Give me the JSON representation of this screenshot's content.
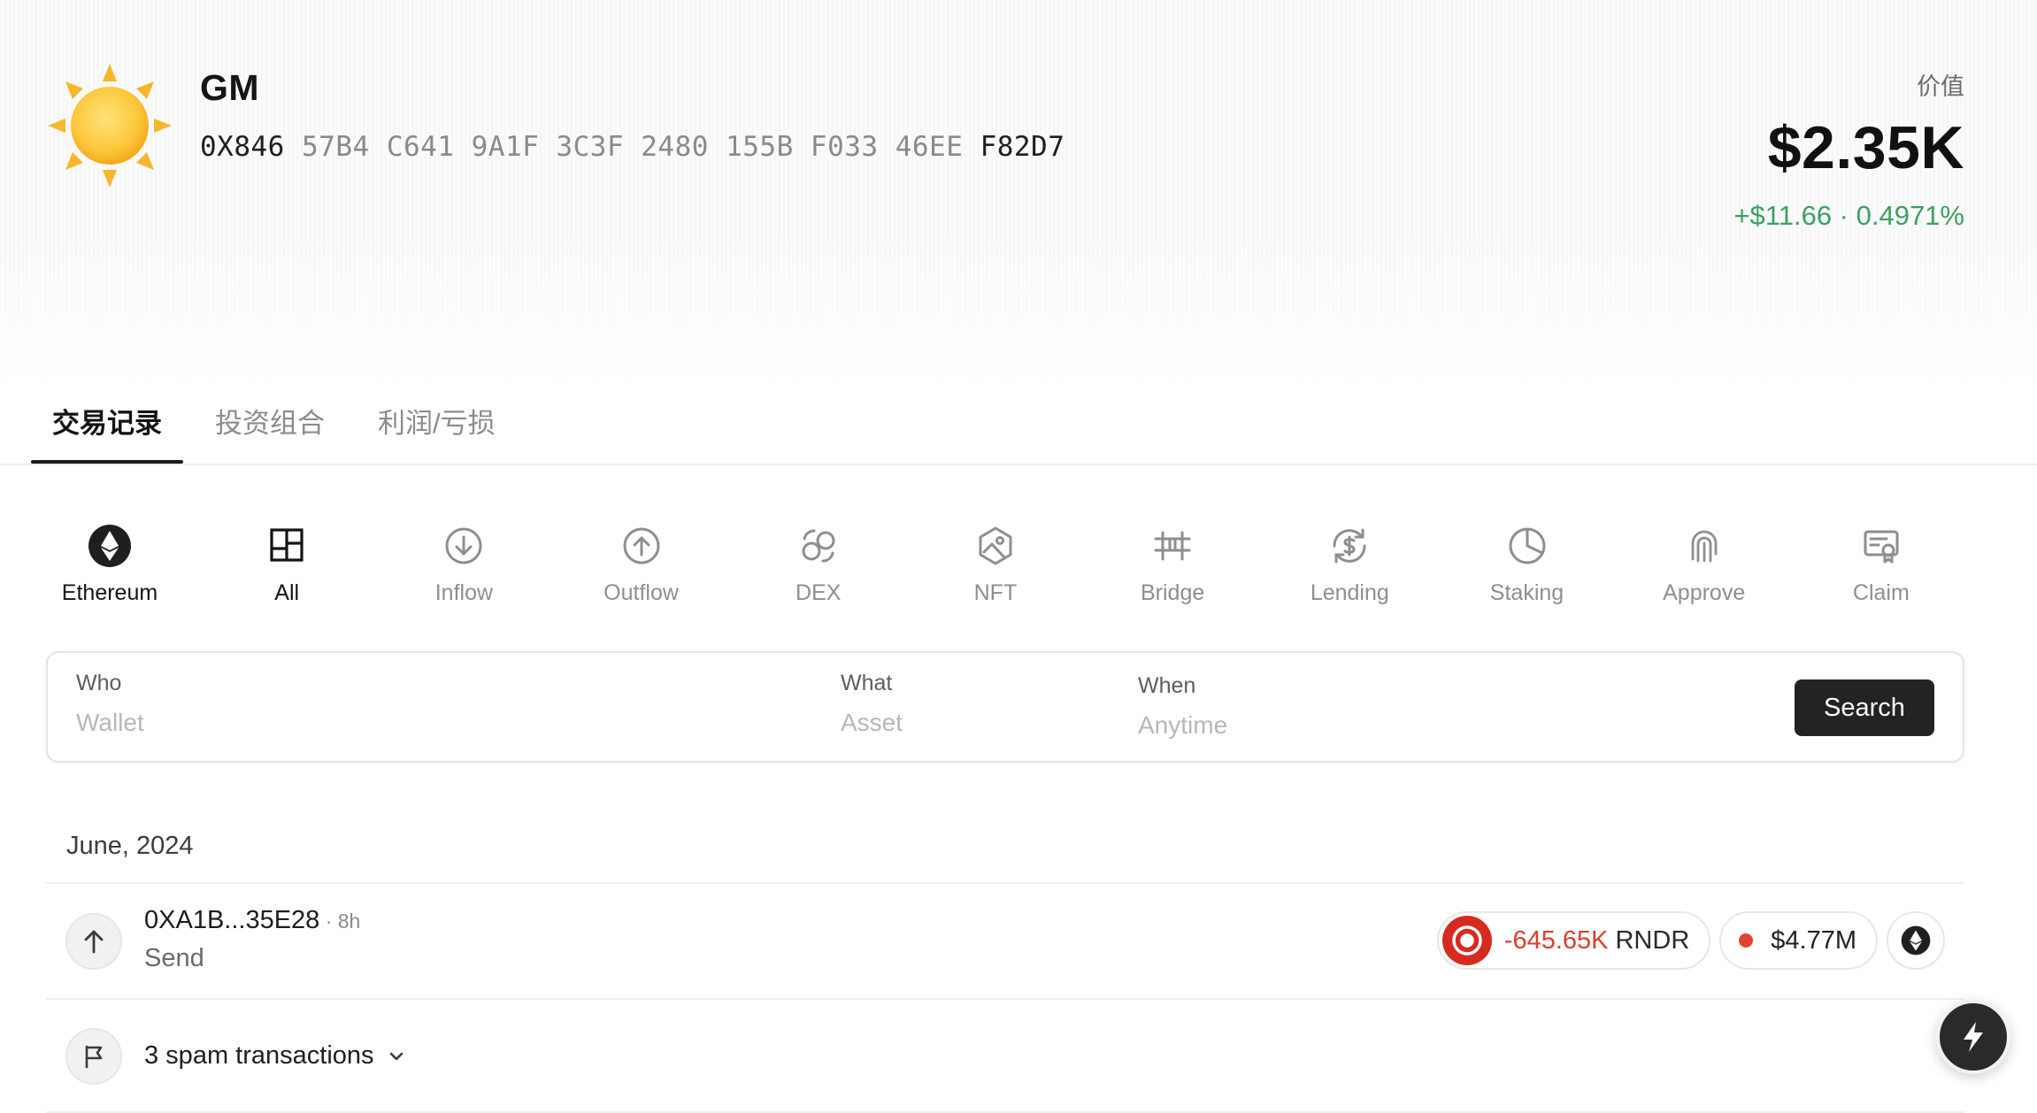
{
  "profile": {
    "name": "GM",
    "avatar": "sun-icon",
    "address_start": "0X846",
    "address_middle": "57B4 C641 9A1F 3C3F 2480 155B F033 46EE",
    "address_end": "F82D7"
  },
  "portfolio": {
    "label": "价值",
    "value": "$2.35K",
    "change": "+$11.66 · 0.4971%",
    "change_color": "#3aa160"
  },
  "tabs": [
    {
      "label": "交易记录",
      "active": true
    },
    {
      "label": "投资组合",
      "active": false
    },
    {
      "label": "利润/亏损",
      "active": false
    }
  ],
  "categories": [
    {
      "label": "Ethereum",
      "icon": "ethereum-icon",
      "active": true
    },
    {
      "label": "All",
      "icon": "grid-icon",
      "active": true
    },
    {
      "label": "Inflow",
      "icon": "arrow-down-circle-icon",
      "active": false
    },
    {
      "label": "Outflow",
      "icon": "arrow-up-circle-icon",
      "active": false
    },
    {
      "label": "DEX",
      "icon": "swap-icon",
      "active": false
    },
    {
      "label": "NFT",
      "icon": "image-hexagon-icon",
      "active": false
    },
    {
      "label": "Bridge",
      "icon": "bridge-icon",
      "active": false
    },
    {
      "label": "Lending",
      "icon": "lending-icon",
      "active": false
    },
    {
      "label": "Staking",
      "icon": "pie-chart-icon",
      "active": false
    },
    {
      "label": "Approve",
      "icon": "fingerprint-icon",
      "active": false
    },
    {
      "label": "Claim",
      "icon": "certificate-icon",
      "active": false
    }
  ],
  "search": {
    "who_label": "Who",
    "who_placeholder": "Wallet",
    "what_label": "What",
    "what_placeholder": "Asset",
    "when_label": "When",
    "when_placeholder": "Anytime",
    "button": "Search"
  },
  "list": {
    "month": "June, 2024",
    "transaction": {
      "address": "0XA1B...35E28",
      "time": " · 8h",
      "type": "Send",
      "amount": "-645.65K",
      "token": "RNDR",
      "usd": "$4.77M",
      "token_color": "#d62b1f",
      "amount_color": "#d8402f"
    },
    "spam": "3 spam transactions"
  }
}
